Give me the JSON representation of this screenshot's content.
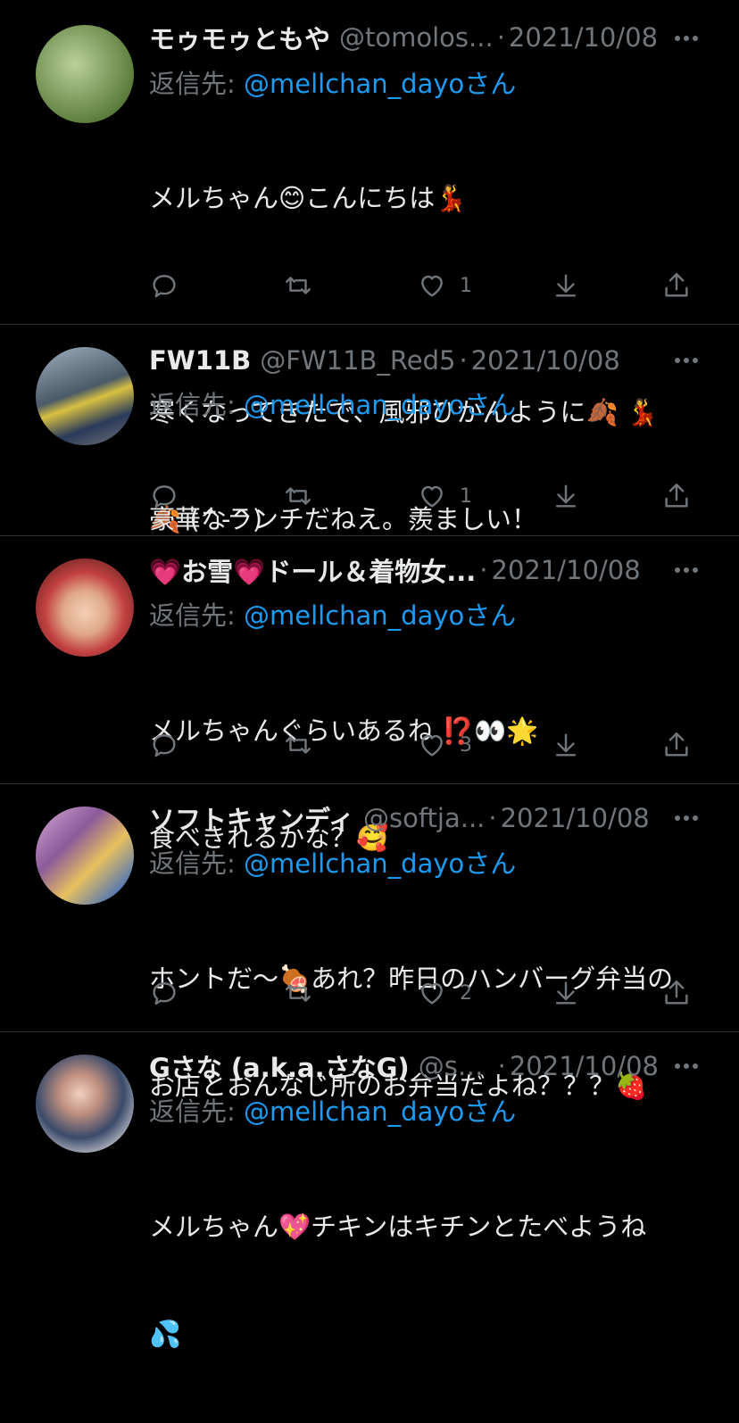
{
  "tweets": [
    {
      "name": "モゥモゥともや",
      "handle": "@tomolos...",
      "date": "2021/10/08",
      "reply_label": "返信先:",
      "reply_mention": "@mellchan_dayo",
      "reply_suffix": "さん",
      "text_lines": [
        "メルちゃん😊こんにちは💃",
        "",
        "寒くなってきたで、風邪ひかんように🍂 💃",
        "🍂 (^-^)"
      ],
      "likes": "1",
      "avatar_color": "#7a9a5a"
    },
    {
      "name": "FW11B",
      "handle": "@FW11B_Red5",
      "date": "2021/10/08",
      "reply_label": "返信先:",
      "reply_mention": "@mellchan_dayo",
      "reply_suffix": "さん",
      "text_lines": [
        "豪華なランチだねえ。羨ましい！"
      ],
      "likes": "1",
      "avatar_color": "#6a7a8a"
    },
    {
      "name": "💗お雪💗ドール＆着物女...",
      "handle": "",
      "date": "2021/10/08",
      "reply_label": "返信先:",
      "reply_mention": "@mellchan_dayo",
      "reply_suffix": "さん",
      "text_lines": [
        "メルちゃんぐらいあるね ⁉️👀🌟",
        "食べきれるかな？🥰"
      ],
      "likes": "3",
      "avatar_color": "#b06060"
    },
    {
      "name": "ソフトキャンディ",
      "handle": "@softja...",
      "date": "2021/10/08",
      "reply_label": "返信先:",
      "reply_mention": "@mellchan_dayo",
      "reply_suffix": "さん",
      "text_lines": [
        "ホントだ〜🍖あれ？昨日のハンバーグ弁当の",
        "お店とおんなじ所のお弁当だよね？？？🍓"
      ],
      "likes": "2",
      "avatar_color": "#a07aa0"
    },
    {
      "name": "Gさな (a.k.a.さなG)",
      "handle": "@sa...",
      "date": "2021/10/08",
      "reply_label": "返信先:",
      "reply_mention": "@mellchan_dayo",
      "reply_suffix": "さん",
      "text_lines": [
        "メルちゃん💖チキンはキチンとたべようね",
        "💦"
      ],
      "likes": "",
      "avatar_color": "#8a8a9a"
    }
  ],
  "icons": {
    "reply": "reply-icon",
    "retweet": "retweet-icon",
    "like": "heart-icon",
    "bookmark": "bookmark-icon",
    "share": "share-icon",
    "more": "more-icon"
  },
  "colors": {
    "background": "#000000",
    "text": "#e7e9ea",
    "muted": "#71767b",
    "link": "#1d9bf0",
    "divider": "#2f3336"
  }
}
